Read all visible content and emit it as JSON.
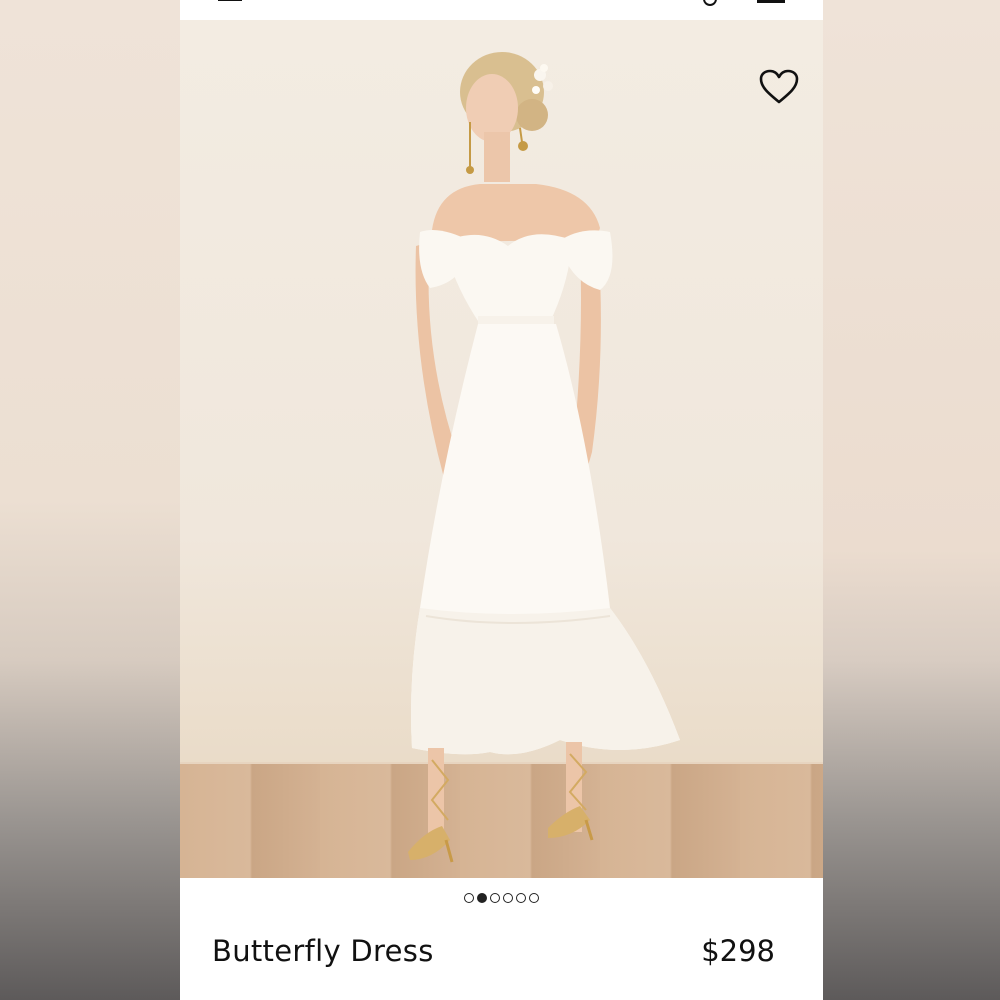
{
  "product": {
    "name": "Butterfly Dress",
    "price": "$298",
    "image_alt": "Model wearing white off-shoulder Butterfly Dress",
    "favorite_icon": "heart-outline-icon"
  },
  "gallery": {
    "total_images": 6,
    "active_index": 1
  },
  "colors": {
    "dress": "#fbf8f2",
    "background": "#f1e9de",
    "floor": "#d4b293"
  }
}
